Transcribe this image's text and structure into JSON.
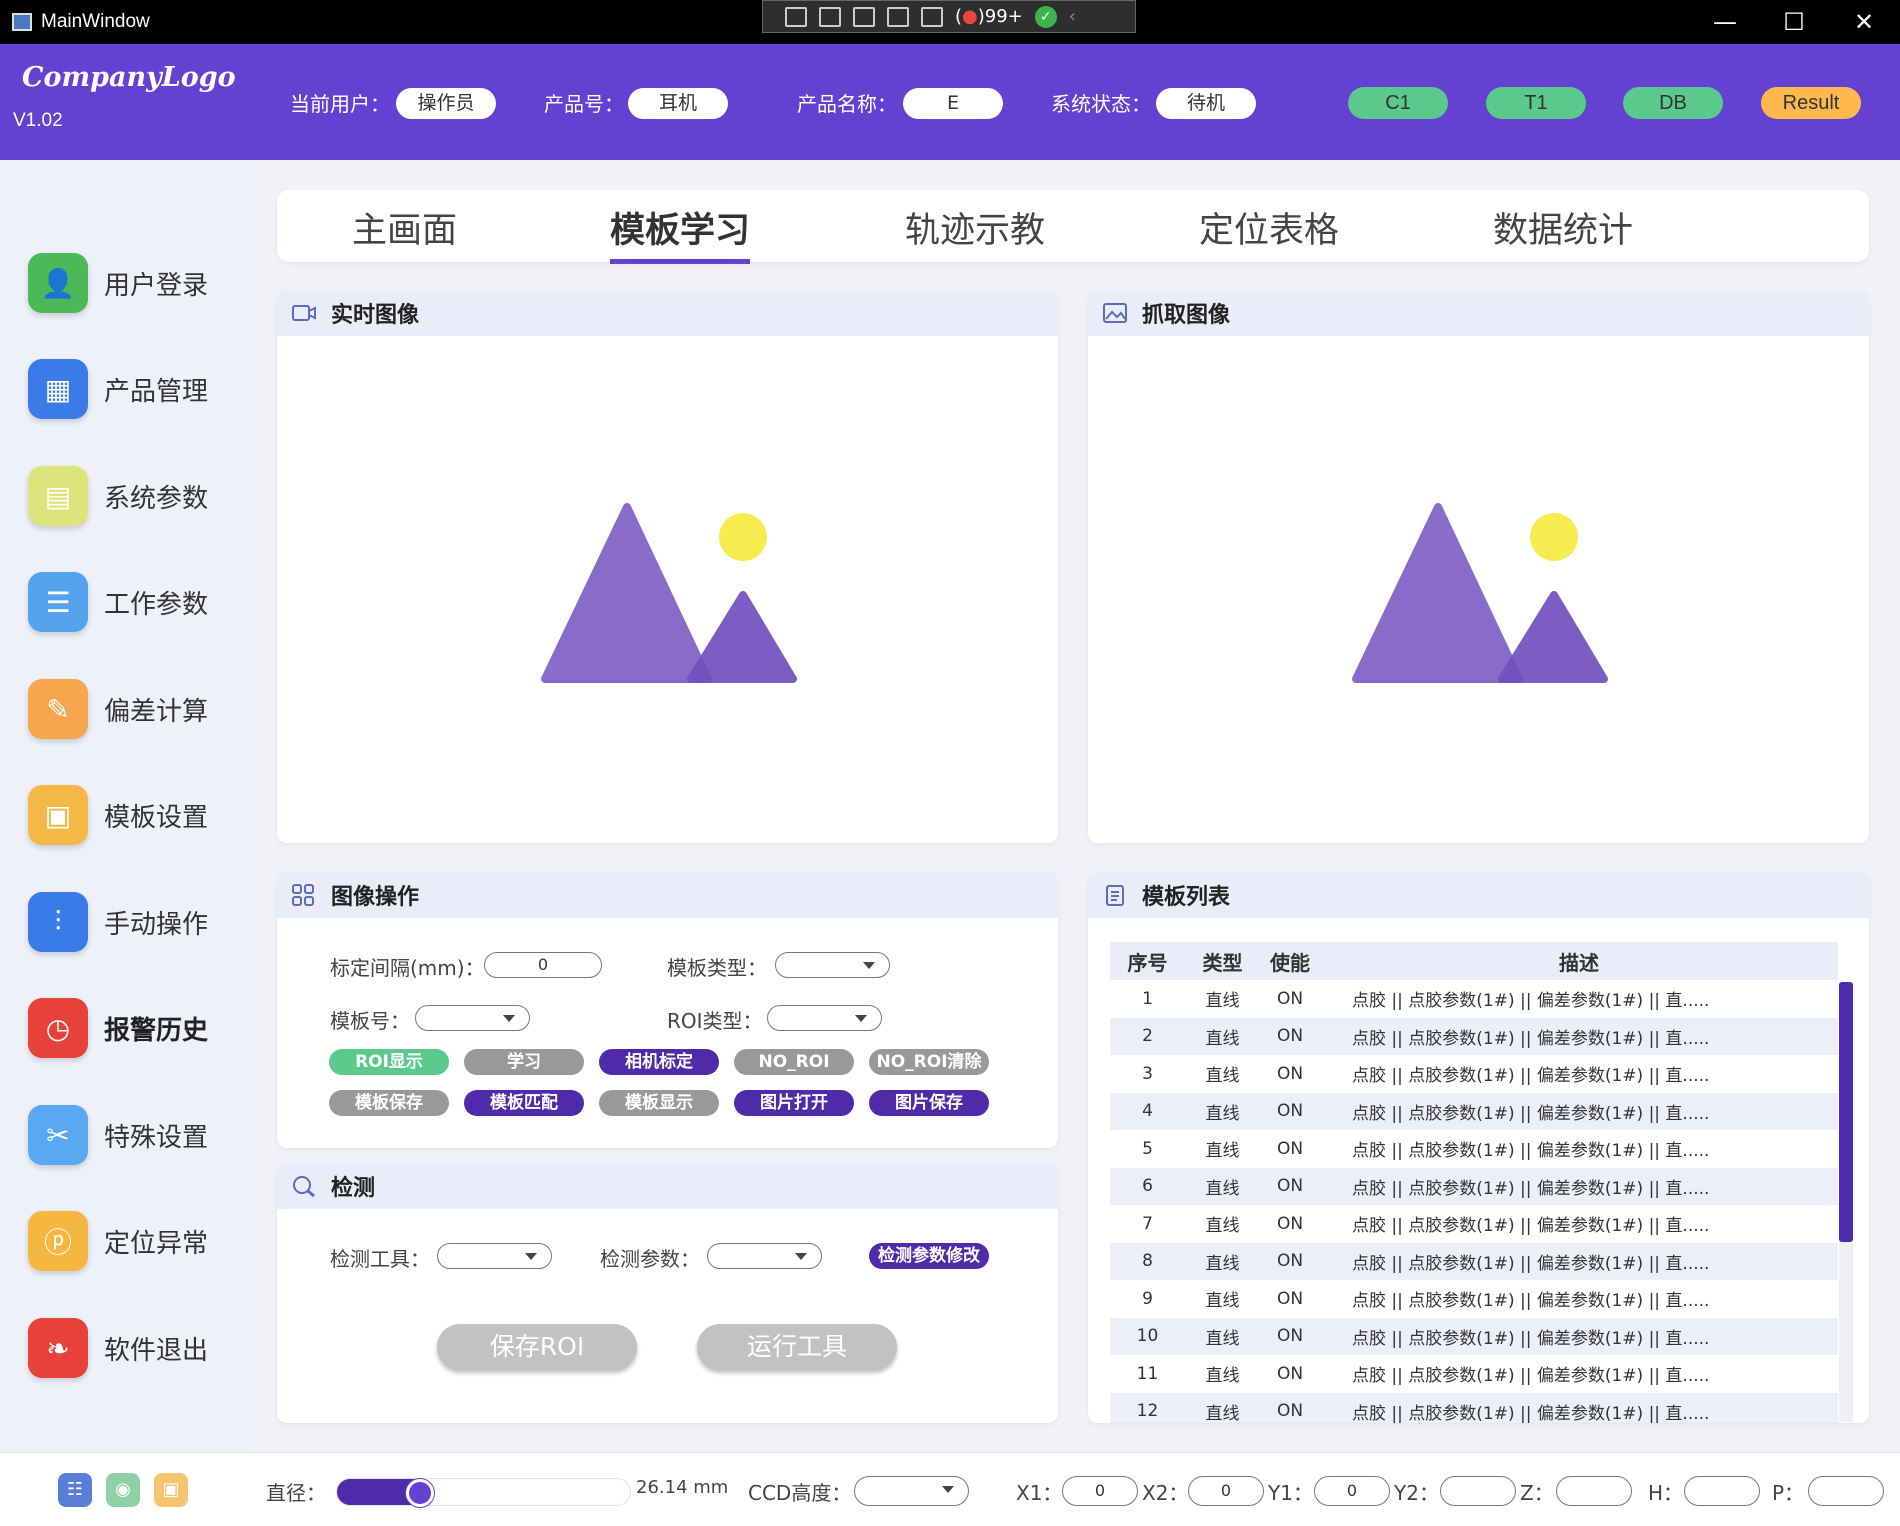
{
  "window": {
    "title": "MainWindow",
    "badge": "99+"
  },
  "header": {
    "logo": "CompanyLogo",
    "version": "V1.02",
    "fields": [
      {
        "label": "当前用户：",
        "value": "操作员"
      },
      {
        "label": "产品号：",
        "value": "耳机"
      },
      {
        "label": "产品名称：",
        "value": "E"
      },
      {
        "label": "系统状态：",
        "value": "待机"
      }
    ],
    "status": [
      {
        "label": "C1",
        "color": "#5cc98c"
      },
      {
        "label": "T1",
        "color": "#5cc98c"
      },
      {
        "label": "DB",
        "color": "#5cc98c"
      },
      {
        "label": "Result",
        "color": "#ffb84d"
      }
    ]
  },
  "sidebar": {
    "items": [
      {
        "label": "用户登录",
        "icon": "user-icon",
        "color": "#4cb858"
      },
      {
        "label": "产品管理",
        "icon": "grid-icon",
        "color": "#3a7be8"
      },
      {
        "label": "系统参数",
        "icon": "doc-settings-icon",
        "color": "#dfe37b"
      },
      {
        "label": "工作参数",
        "icon": "clipboard-icon",
        "color": "#55a3ef"
      },
      {
        "label": "偏差计算",
        "icon": "edit-icon",
        "color": "#f7a54e"
      },
      {
        "label": "模板设置",
        "icon": "template-icon",
        "color": "#f4b846"
      },
      {
        "label": "手动操作",
        "icon": "sliders-icon",
        "color": "#3b7be7"
      },
      {
        "label": "报警历史",
        "icon": "alarm-history-icon",
        "color": "#e8413a"
      },
      {
        "label": "特殊设置",
        "icon": "tools-icon",
        "color": "#5aa7f2"
      },
      {
        "label": "定位异常",
        "icon": "location-icon",
        "color": "#f5b73f"
      },
      {
        "label": "软件退出",
        "icon": "leaf-icon",
        "color": "#e8413a"
      }
    ],
    "active": "报警历史"
  },
  "tabs": [
    {
      "label": "主画面"
    },
    {
      "label": "模板学习"
    },
    {
      "label": "轨迹示教"
    },
    {
      "label": "定位表格"
    },
    {
      "label": "数据统计"
    }
  ],
  "active_tab": "模板学习",
  "panels": {
    "live": {
      "title": "实时图像"
    },
    "capture": {
      "title": "抓取图像"
    },
    "image_ops": {
      "title": "图像操作",
      "calib_label": "标定间隔(mm)：",
      "calib_value": "0",
      "tpl_type_label": "模板类型：",
      "tpl_no_label": "模板号：",
      "roi_type_label": "ROI类型：",
      "buttons_row1": [
        {
          "label": "ROI显示",
          "style": "green"
        },
        {
          "label": "学习",
          "style": "gray"
        },
        {
          "label": "相机标定",
          "style": "purple"
        },
        {
          "label": "NO_ROI",
          "style": "gray"
        },
        {
          "label": "NO_ROI清除",
          "style": "gray"
        }
      ],
      "buttons_row2": [
        {
          "label": "模板保存",
          "style": "gray"
        },
        {
          "label": "模板匹配",
          "style": "purple"
        },
        {
          "label": "模板显示",
          "style": "gray"
        },
        {
          "label": "图片打开",
          "style": "purple"
        },
        {
          "label": "图片保存",
          "style": "purple"
        }
      ]
    },
    "detect": {
      "title": "检测",
      "tool_label": "检测工具：",
      "param_label": "检测参数：",
      "modify_button": "检测参数修改",
      "save_roi": "保存ROI",
      "run_tool": "运行工具"
    },
    "template_list": {
      "title": "模板列表",
      "columns": [
        "序号",
        "类型",
        "使能",
        "描述"
      ],
      "rows": [
        [
          "1",
          "直线",
          "ON",
          "点胶 || 点胶参数(1#) || 偏差参数(1#) || 直....."
        ],
        [
          "2",
          "直线",
          "ON",
          "点胶 || 点胶参数(1#) || 偏差参数(1#) || 直....."
        ],
        [
          "3",
          "直线",
          "ON",
          "点胶 || 点胶参数(1#) || 偏差参数(1#) || 直....."
        ],
        [
          "4",
          "直线",
          "ON",
          "点胶 || 点胶参数(1#) || 偏差参数(1#) || 直....."
        ],
        [
          "5",
          "直线",
          "ON",
          "点胶 || 点胶参数(1#) || 偏差参数(1#) || 直....."
        ],
        [
          "6",
          "直线",
          "ON",
          "点胶 || 点胶参数(1#) || 偏差参数(1#) || 直....."
        ],
        [
          "7",
          "直线",
          "ON",
          "点胶 || 点胶参数(1#) || 偏差参数(1#) || 直....."
        ],
        [
          "8",
          "直线",
          "ON",
          "点胶 || 点胶参数(1#) || 偏差参数(1#) || 直....."
        ],
        [
          "9",
          "直线",
          "ON",
          "点胶 || 点胶参数(1#) || 偏差参数(1#) || 直....."
        ],
        [
          "10",
          "直线",
          "ON",
          "点胶 || 点胶参数(1#) || 偏差参数(1#) || 直....."
        ],
        [
          "11",
          "直线",
          "ON",
          "点胶 || 点胶参数(1#) || 偏差参数(1#) || 直....."
        ],
        [
          "12",
          "直线",
          "ON",
          "点胶 || 点胶参数(1#) || 偏差参数(1#) || 直....."
        ]
      ]
    }
  },
  "bottom": {
    "diameter_label": "直径：",
    "diameter_value": "26.14",
    "diameter_unit": "mm",
    "diameter_fraction": 0.28,
    "ccd_label": "CCD高度：",
    "coords": [
      {
        "label": "X1：",
        "value": "0"
      },
      {
        "label": "X2：",
        "value": "0"
      },
      {
        "label": "Y1：",
        "value": "0"
      },
      {
        "label": "Y2：",
        "value": ""
      },
      {
        "label": "Z：",
        "value": ""
      },
      {
        "label": "H：",
        "value": ""
      },
      {
        "label": "P：",
        "value": ""
      }
    ]
  },
  "colors": {
    "accent": "#6441d0",
    "accent_dark": "#4f2aa9",
    "sun": "#f7ec4f",
    "mountain": "#8a6bc9"
  }
}
